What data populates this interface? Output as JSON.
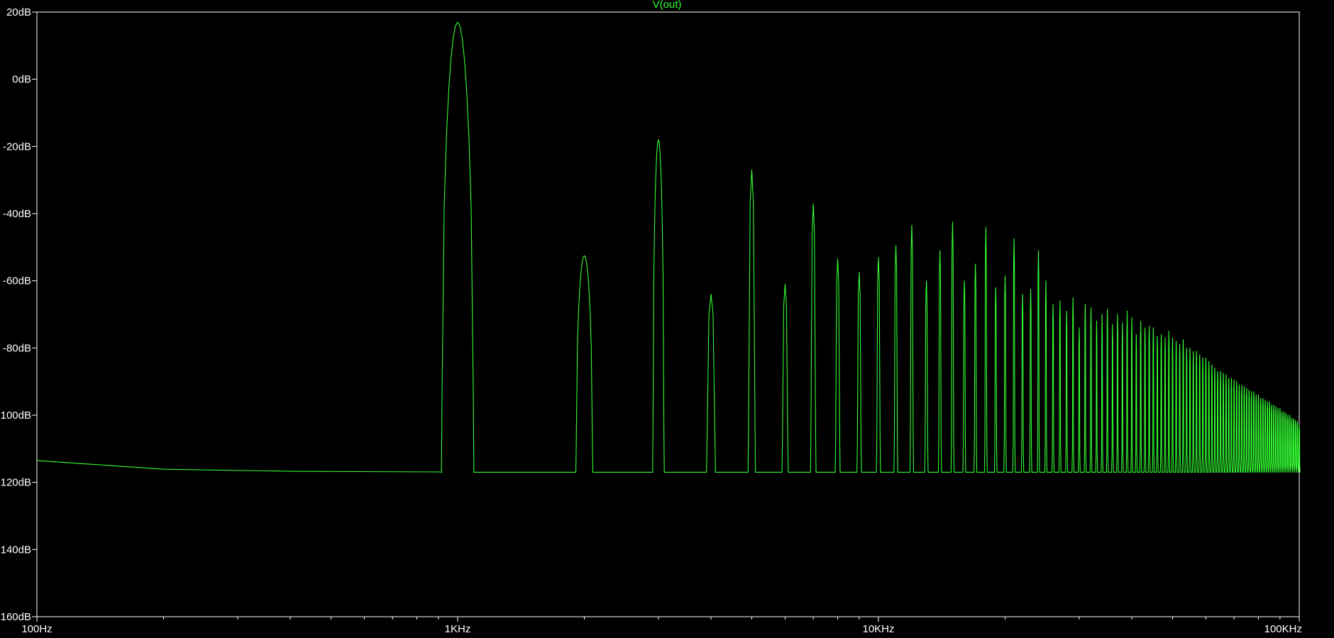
{
  "chart_data": {
    "type": "line",
    "title": "V(out)",
    "x_scale": "log",
    "xlim": [
      100,
      100000
    ],
    "ylim": [
      -160,
      20
    ],
    "x_ticks": [
      {
        "value": 100,
        "label": "100Hz"
      },
      {
        "value": 1000,
        "label": "1KHz"
      },
      {
        "value": 10000,
        "label": "10KHz"
      },
      {
        "value": 100000,
        "label": "100KHz"
      }
    ],
    "y_ticks": [
      {
        "value": 20,
        "label": "20dB"
      },
      {
        "value": 0,
        "label": "0dB"
      },
      {
        "value": -20,
        "label": "-20dB"
      },
      {
        "value": -40,
        "label": "-40dB"
      },
      {
        "value": -60,
        "label": "-60dB"
      },
      {
        "value": -80,
        "label": "-80dB"
      },
      {
        "value": -100,
        "label": "-100dB"
      },
      {
        "value": -120,
        "label": "-120dB"
      },
      {
        "value": -140,
        "label": "-140dB"
      },
      {
        "value": -160,
        "label": "-160dB"
      }
    ],
    "grid": false,
    "series": [
      {
        "name": "V(out)",
        "color": "#33ff33",
        "noise_floor_db": -117,
        "baseline": [
          [
            100,
            -113.5
          ],
          [
            200,
            -116.1
          ],
          [
            400,
            -116.7
          ],
          [
            900,
            -116.9
          ]
        ],
        "harmonic_peaks": [
          {
            "f": 1000,
            "db": 17
          },
          {
            "f": 2000,
            "db": -52.5
          },
          {
            "f": 3000,
            "db": -18
          },
          {
            "f": 4000,
            "db": -64
          },
          {
            "f": 5000,
            "db": -27
          },
          {
            "f": 6000,
            "db": -61
          },
          {
            "f": 7000,
            "db": -37
          },
          {
            "f": 8000,
            "db": -53.5
          },
          {
            "f": 9000,
            "db": -57.5
          },
          {
            "f": 10000,
            "db": -53
          },
          {
            "f": 11000,
            "db": -49.5
          },
          {
            "f": 12000,
            "db": -43.5
          },
          {
            "f": 13000,
            "db": -60
          },
          {
            "f": 14000,
            "db": -51
          },
          {
            "f": 15000,
            "db": -42.5
          },
          {
            "f": 16000,
            "db": -60
          },
          {
            "f": 17000,
            "db": -55
          },
          {
            "f": 18000,
            "db": -44
          },
          {
            "f": 19000,
            "db": -62
          },
          {
            "f": 20000,
            "db": -58.5
          },
          {
            "f": 21000,
            "db": -47.5
          },
          {
            "f": 22000,
            "db": -64
          },
          {
            "f": 23000,
            "db": -62.5
          },
          {
            "f": 24000,
            "db": -51
          },
          {
            "f": 25000,
            "db": -60
          },
          {
            "f": 26000,
            "db": -67
          },
          {
            "f": 27000,
            "db": -66
          },
          {
            "f": 28000,
            "db": -69
          },
          {
            "f": 29000,
            "db": -65
          },
          {
            "f": 30000,
            "db": -74
          },
          {
            "f": 31000,
            "db": -67
          },
          {
            "f": 32000,
            "db": -68
          },
          {
            "f": 33000,
            "db": -72
          },
          {
            "f": 34000,
            "db": -70
          },
          {
            "f": 35000,
            "db": -68.5
          },
          {
            "f": 36000,
            "db": -73
          },
          {
            "f": 37000,
            "db": -70
          },
          {
            "f": 38000,
            "db": -72.5
          },
          {
            "f": 39000,
            "db": -69
          },
          {
            "f": 40000,
            "db": -71
          },
          {
            "f": 41000,
            "db": -76
          },
          {
            "f": 42000,
            "db": -72
          },
          {
            "f": 43000,
            "db": -74
          },
          {
            "f": 44000,
            "db": -73.5
          },
          {
            "f": 45000,
            "db": -74
          },
          {
            "f": 46000,
            "db": -76.5
          },
          {
            "f": 47000,
            "db": -76
          },
          {
            "f": 48000,
            "db": -77
          },
          {
            "f": 49000,
            "db": -75
          },
          {
            "f": 50000,
            "db": -77
          },
          {
            "f": 51000,
            "db": -78
          },
          {
            "f": 52000,
            "db": -79
          },
          {
            "f": 53000,
            "db": -77.5
          },
          {
            "f": 54000,
            "db": -80
          },
          {
            "f": 55000,
            "db": -80
          },
          {
            "f": 56000,
            "db": -81
          },
          {
            "f": 57000,
            "db": -81
          },
          {
            "f": 58000,
            "db": -82
          },
          {
            "f": 59000,
            "db": -83
          },
          {
            "f": 60000,
            "db": -83
          },
          {
            "f": 61000,
            "db": -84
          },
          {
            "f": 62000,
            "db": -85
          },
          {
            "f": 63000,
            "db": -86
          },
          {
            "f": 64000,
            "db": -87
          },
          {
            "f": 65000,
            "db": -87
          },
          {
            "f": 66000,
            "db": -87.5
          },
          {
            "f": 67000,
            "db": -88
          },
          {
            "f": 68000,
            "db": -89
          },
          {
            "f": 69000,
            "db": -89
          },
          {
            "f": 70000,
            "db": -89.5
          },
          {
            "f": 71000,
            "db": -90
          },
          {
            "f": 72000,
            "db": -91
          },
          {
            "f": 73000,
            "db": -91
          },
          {
            "f": 74000,
            "db": -91.5
          },
          {
            "f": 75000,
            "db": -92
          },
          {
            "f": 76000,
            "db": -92.5
          },
          {
            "f": 77000,
            "db": -93
          },
          {
            "f": 78000,
            "db": -93
          },
          {
            "f": 79000,
            "db": -94
          },
          {
            "f": 80000,
            "db": -94
          },
          {
            "f": 81000,
            "db": -95
          },
          {
            "f": 82000,
            "db": -95
          },
          {
            "f": 83000,
            "db": -95.5
          },
          {
            "f": 84000,
            "db": -96
          },
          {
            "f": 85000,
            "db": -96
          },
          {
            "f": 86000,
            "db": -97
          },
          {
            "f": 87000,
            "db": -97
          },
          {
            "f": 88000,
            "db": -97.5
          },
          {
            "f": 89000,
            "db": -98
          },
          {
            "f": 90000,
            "db": -98
          },
          {
            "f": 91000,
            "db": -99
          },
          {
            "f": 92000,
            "db": -99
          },
          {
            "f": 93000,
            "db": -99.5
          },
          {
            "f": 94000,
            "db": -100
          },
          {
            "f": 95000,
            "db": -100
          },
          {
            "f": 96000,
            "db": -101
          },
          {
            "f": 97000,
            "db": -101
          },
          {
            "f": 98000,
            "db": -101.5
          },
          {
            "f": 99000,
            "db": -102
          },
          {
            "f": 100000,
            "db": -103
          }
        ]
      }
    ]
  }
}
